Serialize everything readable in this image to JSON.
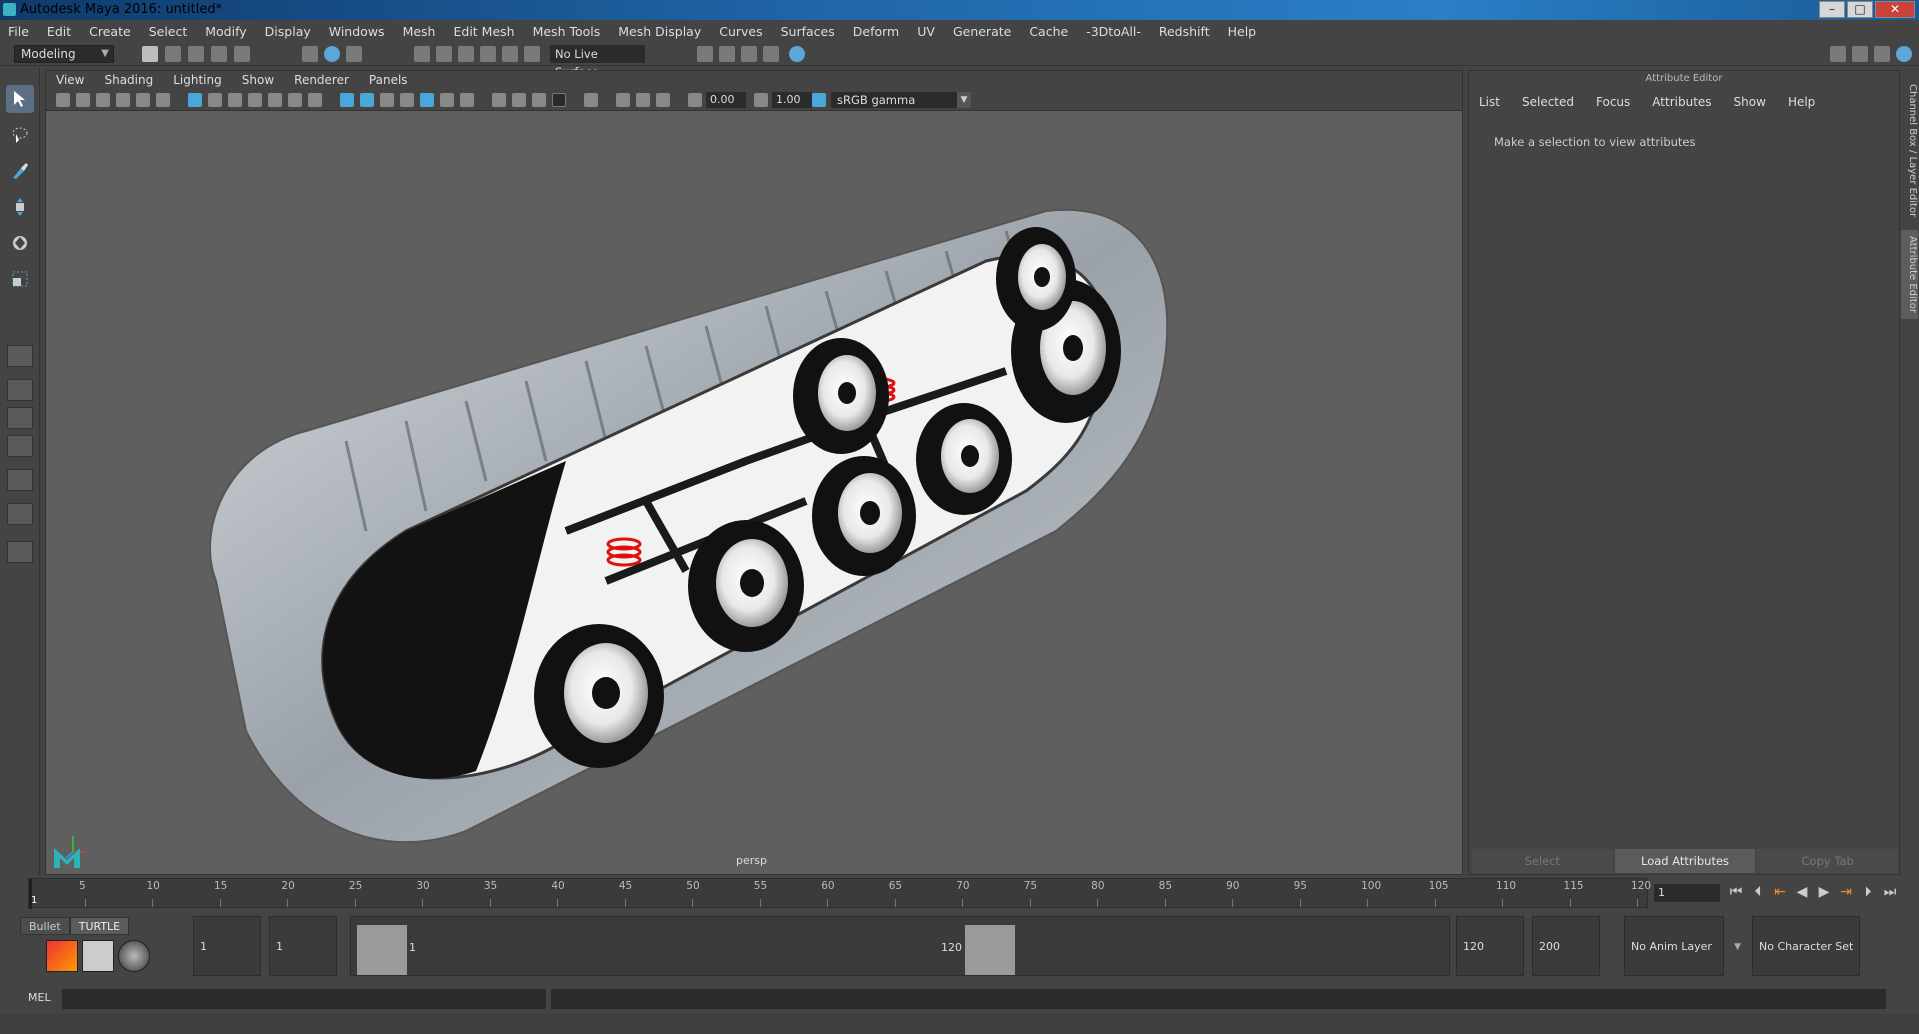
{
  "window": {
    "title": "Autodesk Maya 2016: untitled*",
    "min_glyph": "–",
    "max_glyph": "□",
    "close_glyph": "✕"
  },
  "menubar": {
    "items": [
      "File",
      "Edit",
      "Create",
      "Select",
      "Modify",
      "Display",
      "Windows",
      "Mesh",
      "Edit Mesh",
      "Mesh Tools",
      "Mesh Display",
      "Curves",
      "Surfaces",
      "Deform",
      "UV",
      "Generate",
      "Cache",
      "-3DtoAll-",
      "Redshift",
      "Help"
    ]
  },
  "statusline": {
    "mode": "Modeling",
    "live_surface": "No Live Surface"
  },
  "viewport": {
    "menus": [
      "View",
      "Shading",
      "Lighting",
      "Show",
      "Renderer",
      "Panels"
    ],
    "field_a": "0.00",
    "field_b": "1.00",
    "color_space": "sRGB gamma",
    "camera_label": "persp"
  },
  "attribute_editor": {
    "title": "Attribute Editor",
    "menus": [
      "List",
      "Selected",
      "Focus",
      "Attributes",
      "Show",
      "Help"
    ],
    "empty_message": "Make a selection to view attributes",
    "buttons": [
      "Select",
      "Load Attributes",
      "Copy Tab"
    ],
    "side_tabs": [
      "Channel Box / Layer Editor",
      "Attribute Editor"
    ]
  },
  "timeline": {
    "ticks": [
      5,
      10,
      15,
      20,
      25,
      30,
      35,
      40,
      45,
      50,
      55,
      60,
      65,
      70,
      75,
      80,
      85,
      90,
      95,
      100,
      105,
      110,
      115,
      120
    ],
    "current_frame_label": "1",
    "current_frame_field": "1"
  },
  "range": {
    "shelf_tabs": [
      "Bullet",
      "TURTLE"
    ],
    "start_time": "1",
    "playback_start": "1",
    "range_start_label": "1",
    "range_end_label": "120",
    "playback_end": "120",
    "end_time": "200",
    "anim_layer": "No Anim Layer",
    "character_set": "No Character Set"
  },
  "cmdline": {
    "label": "MEL"
  },
  "colors": {
    "accent": "#5d6f84",
    "track_red": "#d11",
    "playback_key": "#f08b2e"
  }
}
